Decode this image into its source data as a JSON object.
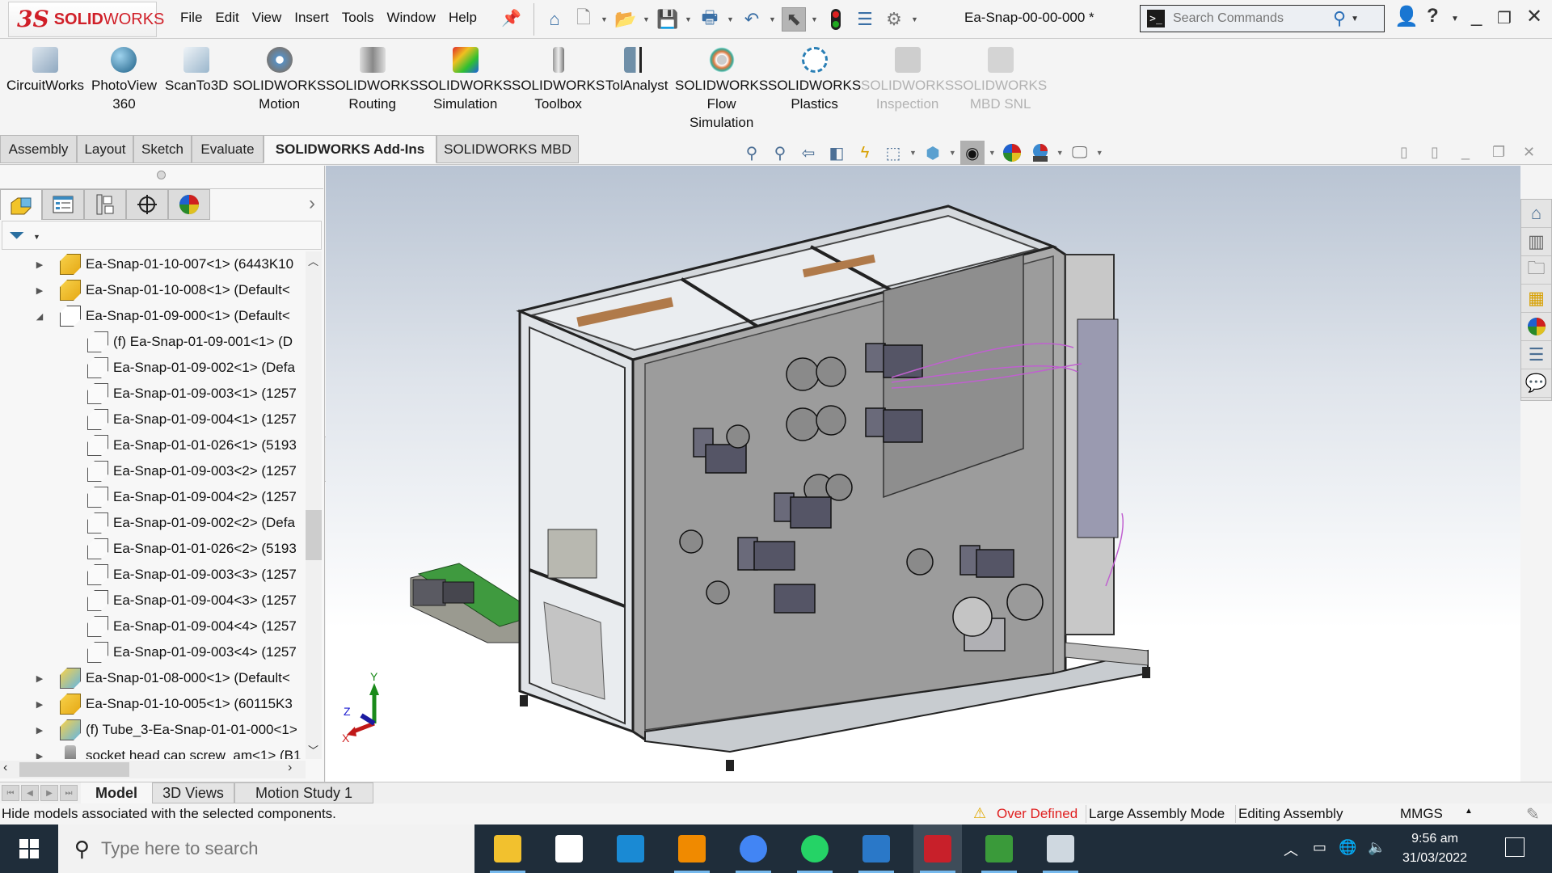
{
  "app": {
    "brand_prefix": "3S",
    "brand_solid": "SOLID",
    "brand_works": "WORKS",
    "document_title": "Ea-Snap-00-00-000 *"
  },
  "menu": [
    "File",
    "Edit",
    "View",
    "Insert",
    "Tools",
    "Window",
    "Help"
  ],
  "quick_access": [
    {
      "name": "home-icon"
    },
    {
      "name": "new-document-icon"
    },
    {
      "name": "open-icon"
    },
    {
      "name": "save-icon"
    },
    {
      "name": "print-icon"
    },
    {
      "name": "undo-icon"
    },
    {
      "name": "select-icon"
    },
    {
      "name": "rebuild-icon"
    },
    {
      "name": "file-properties-icon"
    },
    {
      "name": "options-icon"
    }
  ],
  "search": {
    "placeholder": "Search Commands"
  },
  "ribbon": [
    {
      "label": "CircuitWorks",
      "line2": "",
      "line3": "",
      "enabled": true,
      "color": "#8fa8c0"
    },
    {
      "label": "PhotoView",
      "line2": "360",
      "line3": "",
      "enabled": true,
      "color": "#2e7fa8"
    },
    {
      "label": "ScanTo3D",
      "line2": "",
      "line3": "",
      "enabled": true,
      "color": "#9ab6cc"
    },
    {
      "label": "SOLIDWORKS",
      "line2": "Motion",
      "line3": "",
      "enabled": true,
      "color": "#5a8fbf"
    },
    {
      "label": "SOLIDWORKS",
      "line2": "Routing",
      "line3": "",
      "enabled": true,
      "color": "#a0a0a0"
    },
    {
      "label": "SOLIDWORKS",
      "line2": "Simulation",
      "line3": "",
      "enabled": true,
      "color": "#e05a2a"
    },
    {
      "label": "SOLIDWORKS",
      "line2": "Toolbox",
      "line3": "",
      "enabled": true,
      "color": "#777777"
    },
    {
      "label": "TolAnalyst",
      "line2": "",
      "line3": "",
      "enabled": true,
      "color": "#4a6e8a"
    },
    {
      "label": "SOLIDWORKS",
      "line2": "Flow",
      "line3": "Simulation",
      "enabled": true,
      "color": "#e07a40"
    },
    {
      "label": "SOLIDWORKS",
      "line2": "Plastics",
      "line3": "",
      "enabled": true,
      "color": "#2a7fb5"
    },
    {
      "label": "SOLIDWORKS",
      "line2": "Inspection",
      "line3": "",
      "enabled": false,
      "color": "#a0a0a0"
    },
    {
      "label": "SOLIDWORKS",
      "line2": "MBD SNL",
      "line3": "",
      "enabled": false,
      "color": "#a0a0a0"
    }
  ],
  "command_tabs": [
    {
      "label": "Assembly",
      "active": false
    },
    {
      "label": "Layout",
      "active": false
    },
    {
      "label": "Sketch",
      "active": false
    },
    {
      "label": "Evaluate",
      "active": false
    },
    {
      "label": "SOLIDWORKS Add-Ins",
      "active": true
    },
    {
      "label": "SOLIDWORKS MBD",
      "active": false
    }
  ],
  "feature_tree": {
    "rows": [
      {
        "label": "Ea-Snap-01-10-007<1> (6443K10",
        "level": 1,
        "expander": "collapsed",
        "icon": "asm-y"
      },
      {
        "label": "Ea-Snap-01-10-008<1> (Default<",
        "level": 1,
        "expander": "collapsed",
        "icon": "asm-y"
      },
      {
        "label": "Ea-Snap-01-09-000<1> (Default<",
        "level": 1,
        "expander": "expanded",
        "icon": "asm-w"
      },
      {
        "label": "(f) Ea-Snap-01-09-001<1> (D",
        "level": 2,
        "expander": "none",
        "icon": "part-w"
      },
      {
        "label": "Ea-Snap-01-09-002<1> (Defa",
        "level": 2,
        "expander": "none",
        "icon": "part-w"
      },
      {
        "label": "Ea-Snap-01-09-003<1> (1257",
        "level": 2,
        "expander": "none",
        "icon": "part-w"
      },
      {
        "label": "Ea-Snap-01-09-004<1> (1257",
        "level": 2,
        "expander": "none",
        "icon": "part-w"
      },
      {
        "label": "Ea-Snap-01-01-026<1> (5193",
        "level": 2,
        "expander": "none",
        "icon": "part-w"
      },
      {
        "label": "Ea-Snap-01-09-003<2> (1257",
        "level": 2,
        "expander": "none",
        "icon": "part-w"
      },
      {
        "label": "Ea-Snap-01-09-004<2> (1257",
        "level": 2,
        "expander": "none",
        "icon": "part-w"
      },
      {
        "label": "Ea-Snap-01-09-002<2> (Defa",
        "level": 2,
        "expander": "none",
        "icon": "part-w"
      },
      {
        "label": "Ea-Snap-01-01-026<2> (5193",
        "level": 2,
        "expander": "none",
        "icon": "part-w"
      },
      {
        "label": "Ea-Snap-01-09-003<3> (1257",
        "level": 2,
        "expander": "none",
        "icon": "part-w"
      },
      {
        "label": "Ea-Snap-01-09-004<3> (1257",
        "level": 2,
        "expander": "none",
        "icon": "part-w"
      },
      {
        "label": "Ea-Snap-01-09-004<4> (1257",
        "level": 2,
        "expander": "none",
        "icon": "part-w"
      },
      {
        "label": "Ea-Snap-01-09-003<4> (1257",
        "level": 2,
        "expander": "none",
        "icon": "part-w"
      },
      {
        "label": "Ea-Snap-01-08-000<1> (Default<",
        "level": 1,
        "expander": "collapsed",
        "icon": "asm-b"
      },
      {
        "label": "Ea-Snap-01-10-005<1> (60115K3",
        "level": 1,
        "expander": "collapsed",
        "icon": "asm-y"
      },
      {
        "label": "(f) Tube_3-Ea-Snap-01-01-000<1>",
        "level": 1,
        "expander": "collapsed",
        "icon": "asm-b"
      },
      {
        "label": "socket head cap screw_am<1> (B1",
        "level": 1,
        "expander": "collapsed",
        "icon": "screw"
      }
    ]
  },
  "bottom_tabs": [
    {
      "label": "Model",
      "active": true
    },
    {
      "label": "3D Views",
      "active": false
    },
    {
      "label": "Motion Study 1",
      "active": false
    }
  ],
  "status": {
    "message": "Hide models associated with the selected components.",
    "over_defined": "Over Defined",
    "mode": "Large Assembly Mode",
    "editing": "Editing Assembly",
    "units": "MMGS"
  },
  "triad": {
    "x": "X",
    "y": "Y",
    "z": "Z"
  },
  "taskbar": {
    "search_placeholder": "Type here to search",
    "time": "9:56 am",
    "date": "31/03/2022",
    "apps": [
      {
        "name": "file-explorer",
        "color": "#f2c12e",
        "active": false,
        "running": true
      },
      {
        "name": "microsoft-store",
        "color": "#ffffff",
        "active": false,
        "running": false
      },
      {
        "name": "mail",
        "color": "#1a8ad4",
        "active": false,
        "running": false
      },
      {
        "name": "vlc",
        "color": "#f08a00",
        "active": false,
        "running": true
      },
      {
        "name": "chrome",
        "color": "#4285f4",
        "active": false,
        "running": true
      },
      {
        "name": "whatsapp",
        "color": "#25d366",
        "active": false,
        "running": true
      },
      {
        "name": "photos",
        "color": "#2a78c8",
        "active": false,
        "running": true
      },
      {
        "name": "solidworks-2018",
        "color": "#c8202a",
        "active": true,
        "running": true
      },
      {
        "name": "internet-download-manager",
        "color": "#3a9a3a",
        "active": false,
        "running": true
      },
      {
        "name": "performance-monitor",
        "color": "#cfd8e0",
        "active": false,
        "running": true
      }
    ]
  }
}
